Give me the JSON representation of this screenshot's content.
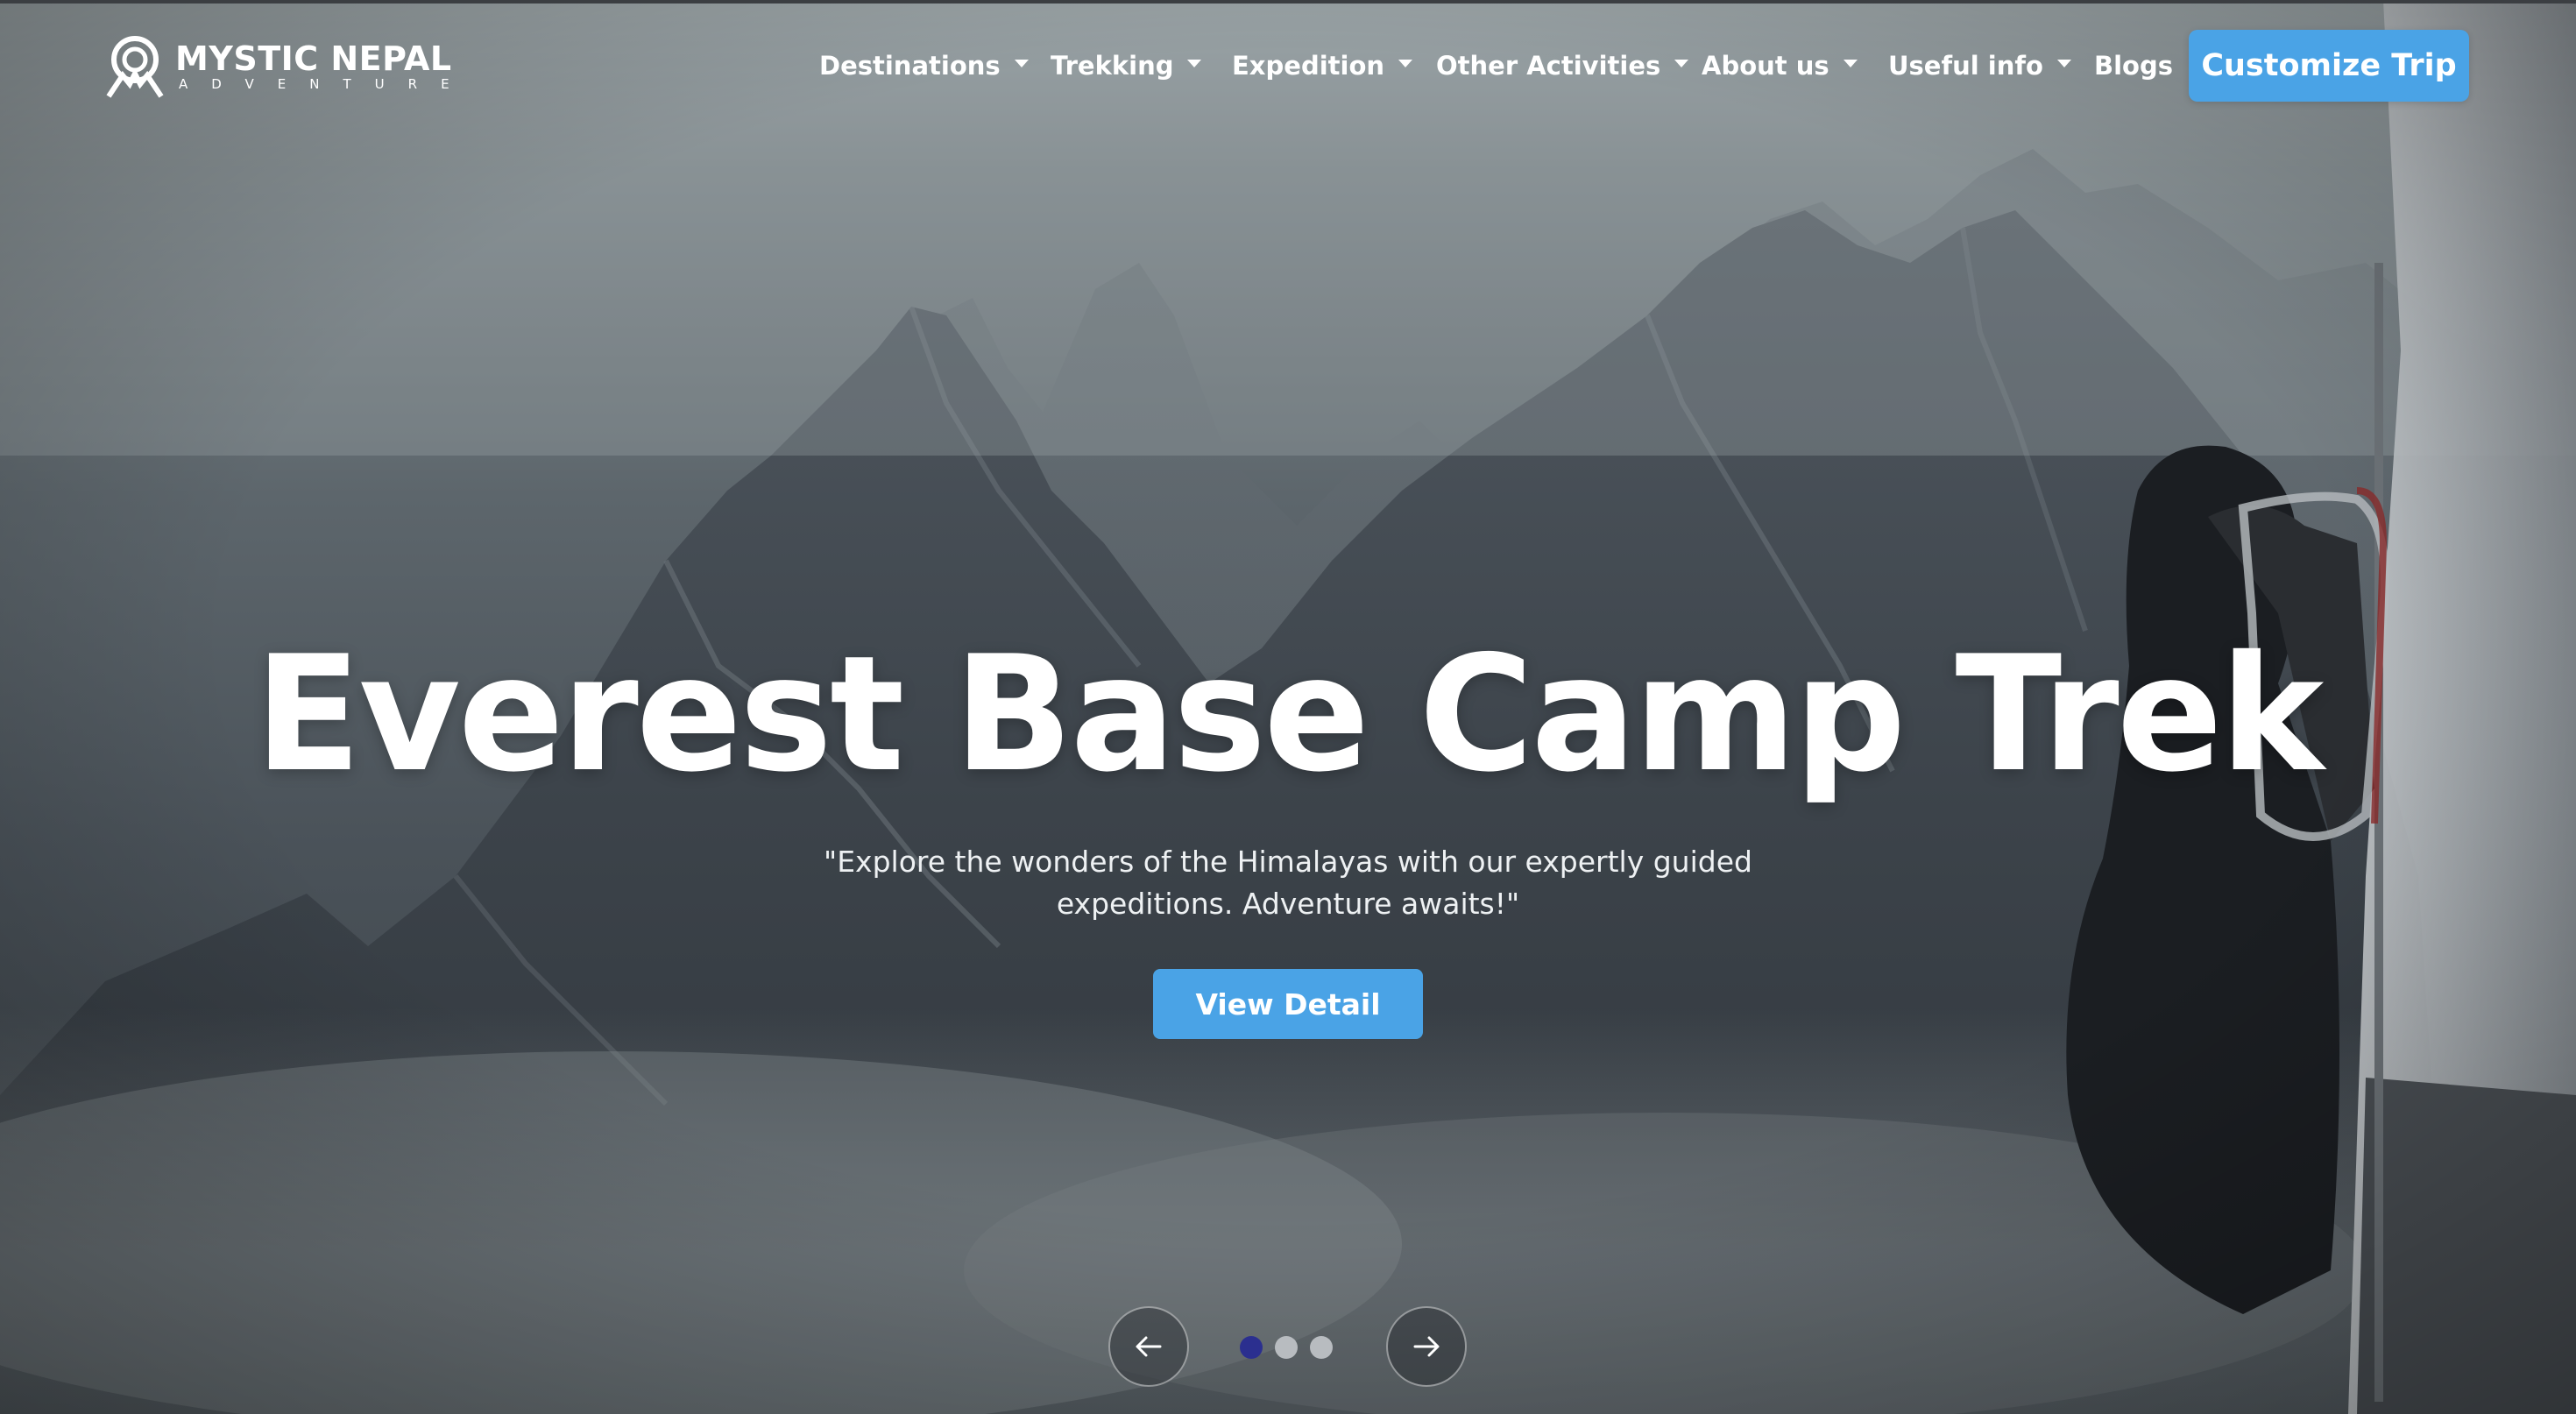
{
  "brand": {
    "name": "MYSTIC NEPAL",
    "tagline": "ADVENTURE"
  },
  "nav": {
    "items": [
      {
        "label": "Destinations",
        "has_dropdown": true
      },
      {
        "label": "Trekking",
        "has_dropdown": true
      },
      {
        "label": "Expedition",
        "has_dropdown": true
      },
      {
        "label": "Other Activities",
        "has_dropdown": true
      },
      {
        "label": "About us",
        "has_dropdown": true
      },
      {
        "label": "Useful info",
        "has_dropdown": true
      },
      {
        "label": "Blogs",
        "has_dropdown": false
      }
    ],
    "cta_label": "Customize Trip"
  },
  "hero": {
    "title": "Everest Base Camp Trek",
    "subtitle_line1": "\"Explore the wonders of the Himalayas with our expertly guided",
    "subtitle_line2": "expeditions. Adventure awaits!\"",
    "button_label": "View Detail"
  },
  "carousel": {
    "slide_count": 3,
    "active_index": 0,
    "prev_icon": "arrow-left-icon",
    "next_icon": "arrow-right-icon"
  },
  "colors": {
    "accent": "#4aa3e6",
    "active_dot": "#2b2f8f",
    "inactive_dot": "#b8bcc0"
  }
}
